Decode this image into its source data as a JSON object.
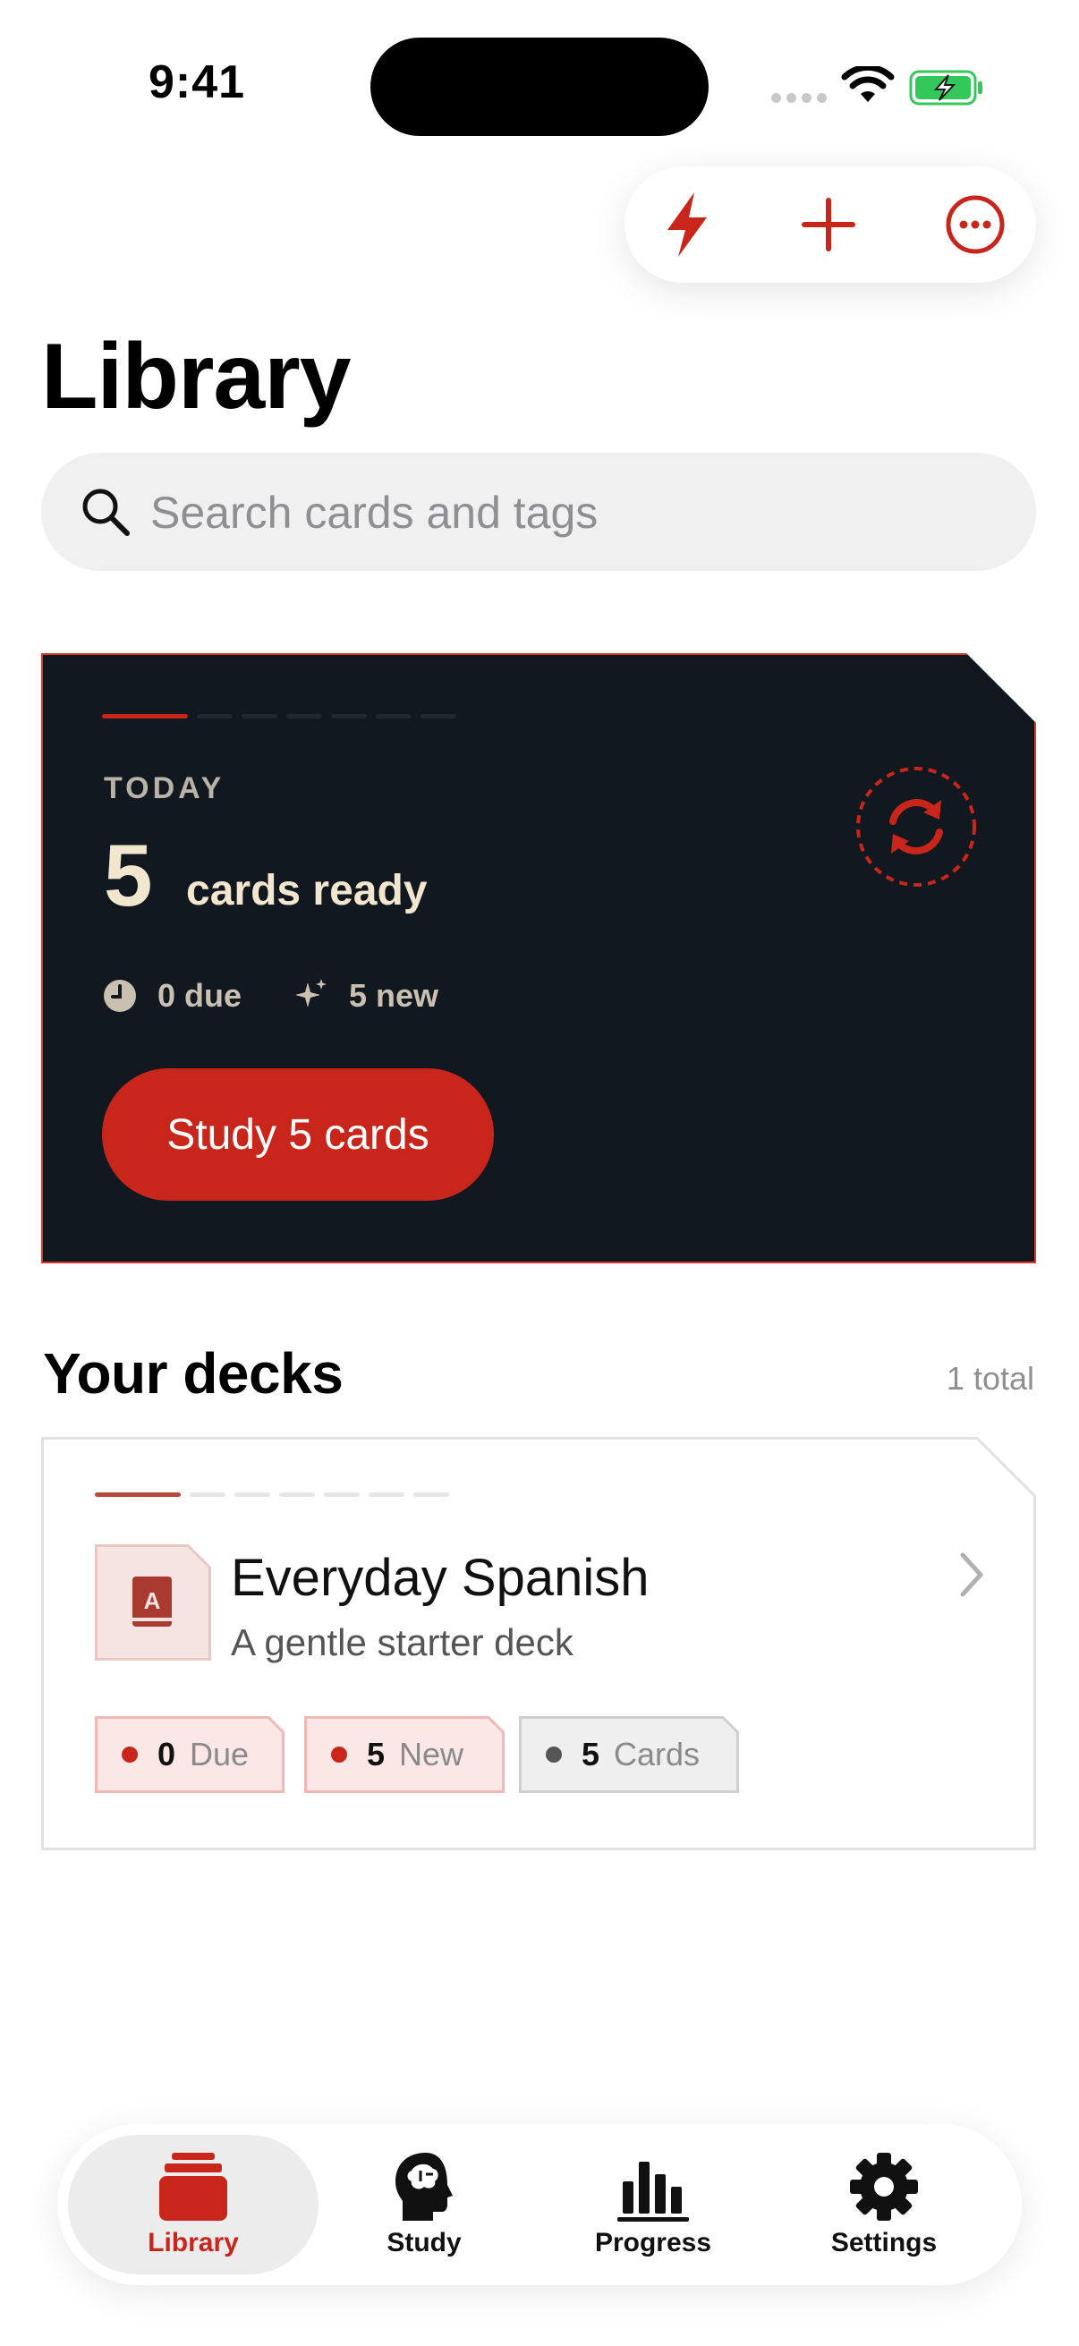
{
  "status": {
    "time": "9:41"
  },
  "header": {
    "title": "Library"
  },
  "search": {
    "placeholder": "Search cards and tags"
  },
  "today": {
    "label": "TODAY",
    "count": "5",
    "count_label": "cards ready",
    "due": "0 due",
    "new": "5 new",
    "study_button": "Study 5 cards"
  },
  "decks": {
    "title": "Your decks",
    "count": "1 total",
    "items": [
      {
        "name": "Everyday Spanish",
        "subtitle": "A gentle starter deck",
        "due": {
          "value": "0",
          "label": "Due"
        },
        "new": {
          "value": "5",
          "label": "New"
        },
        "cards": {
          "value": "5",
          "label": "Cards"
        }
      }
    ]
  },
  "tabs": [
    {
      "label": "Library",
      "icon": "cards-stack-icon"
    },
    {
      "label": "Study",
      "icon": "brain-head-icon"
    },
    {
      "label": "Progress",
      "icon": "bar-chart-icon"
    },
    {
      "label": "Settings",
      "icon": "gear-icon"
    }
  ],
  "colors": {
    "accent": "#c8251b",
    "card_dark": "#111820",
    "cream": "#f3e6cf"
  }
}
